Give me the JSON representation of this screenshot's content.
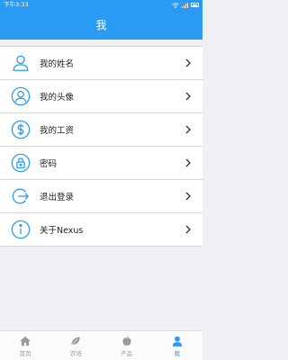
{
  "status_bar": {
    "time": "下午3:33"
  },
  "header": {
    "title": "我"
  },
  "colors": {
    "accent": "#2b9af3",
    "background": "#efeff4",
    "tab_inactive": "#9a9a9a"
  },
  "menu": {
    "items": [
      {
        "label": "我的姓名",
        "icon": "user-icon"
      },
      {
        "label": "我的头像",
        "icon": "avatar-icon"
      },
      {
        "label": "我的工资",
        "icon": "dollar-icon"
      },
      {
        "label": "密码",
        "icon": "lock-icon"
      },
      {
        "label": "退出登录",
        "icon": "logout-icon"
      },
      {
        "label": "关于Nexus",
        "icon": "info-icon"
      }
    ]
  },
  "tabbar": {
    "tabs": [
      {
        "label": "首页",
        "icon": "home-icon",
        "active": false
      },
      {
        "label": "农场",
        "icon": "leaf-icon",
        "active": false
      },
      {
        "label": "产品",
        "icon": "apple-icon",
        "active": false
      },
      {
        "label": "我",
        "icon": "person-icon",
        "active": true
      }
    ]
  }
}
